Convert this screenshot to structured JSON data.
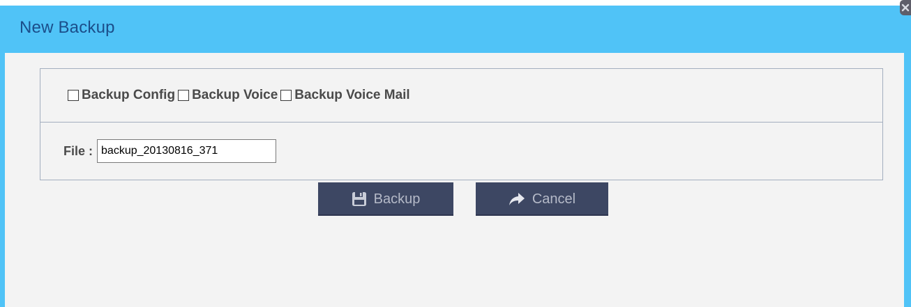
{
  "dialog": {
    "title": "New Backup",
    "close_icon": "close-icon"
  },
  "options": [
    {
      "label": "Backup Config",
      "checked": false
    },
    {
      "label": "Backup Voice",
      "checked": false
    },
    {
      "label": "Backup Voice Mail",
      "checked": false
    }
  ],
  "file": {
    "label": "File :",
    "value": "backup_20130816_371"
  },
  "buttons": {
    "backup_label": "Backup",
    "backup_icon": "floppy-disk-icon",
    "cancel_label": "Cancel",
    "cancel_icon": "arrow-forward-icon"
  },
  "colors": {
    "titlebar": "#50c3f7",
    "title_text": "#1b4e8a",
    "button_bg": "#3d4763",
    "button_text": "#b5bac8",
    "panel_border": "#a3aebf"
  }
}
